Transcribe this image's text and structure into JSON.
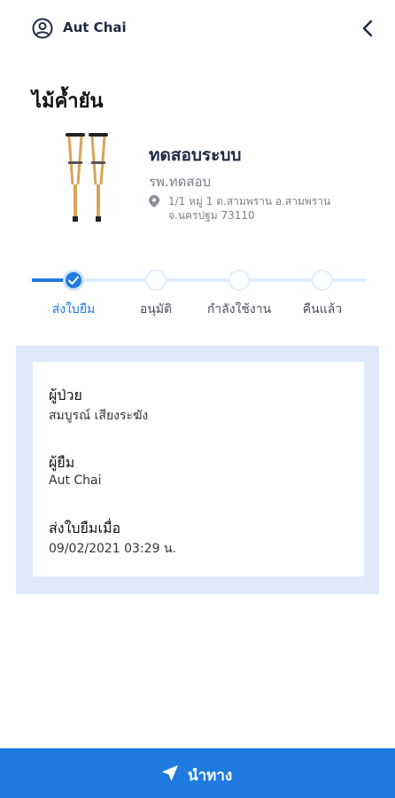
{
  "header": {
    "user_name": "Aut Chai"
  },
  "page_title": "ไม้ค้ำยัน",
  "item": {
    "name": "ทดสอบระบบ",
    "hospital": "รพ.ทดสอบ",
    "address": "1/1 หมู่ 1 ต.สามพราน อ.สามพราน จ.นครปฐม 73110"
  },
  "steps": [
    {
      "label": "ส่งใบยืม",
      "done": true
    },
    {
      "label": "อนุมัติ",
      "done": false
    },
    {
      "label": "กำลังใช้งาน",
      "done": false
    },
    {
      "label": "คืนแล้ว",
      "done": false
    }
  ],
  "info": {
    "patient_label": "ผู้ป่วย",
    "patient_value": "สมบูรณ์ เสียงระฆัง",
    "borrower_label": "ผู้ยืม",
    "borrower_value": "Aut Chai",
    "sent_label": "ส่งใบยืมเมื่อ",
    "sent_value": "09/02/2021 03:29 น."
  },
  "bottom": {
    "nav_label": "นำทาง"
  },
  "colors": {
    "accent": "#1f7be0",
    "track": "#dfeefc",
    "panel": "#dde9f9"
  },
  "icons": [
    "user-circle-icon",
    "chevron-left-icon",
    "map-pin-icon",
    "check-icon",
    "navigation-arrow-icon"
  ]
}
